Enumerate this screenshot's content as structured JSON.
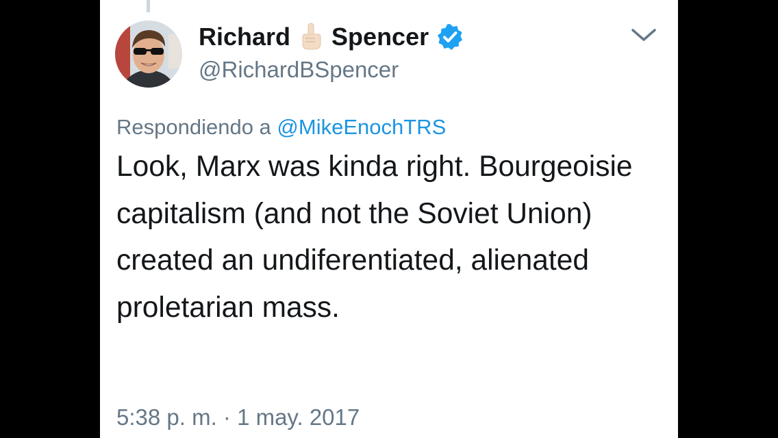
{
  "tweet": {
    "author": {
      "name_first": "Richard",
      "name_last": "Spencer",
      "name_emoji": "pointing-up-emoji",
      "verified": true,
      "handle": "@RichardBSpencer"
    },
    "reply": {
      "prefix": "Respondiendo a",
      "handle": "@MikeEnochTRS"
    },
    "text": "Look, Marx was kinda right. Bourgeoisie capitalism (and not the Soviet Union) created an undiferentiated, alienated proletarian mass.",
    "timestamp": "5:38 p. m. · 1 may. 2017"
  },
  "icons": {
    "menu": "chevron-down-icon",
    "verified": "verified-badge-icon"
  },
  "colors": {
    "text_primary": "#14171a",
    "text_secondary": "#657786",
    "link": "#1b95e0",
    "verified": "#1da1f2",
    "background": "#ffffff",
    "outer": "#000000"
  }
}
